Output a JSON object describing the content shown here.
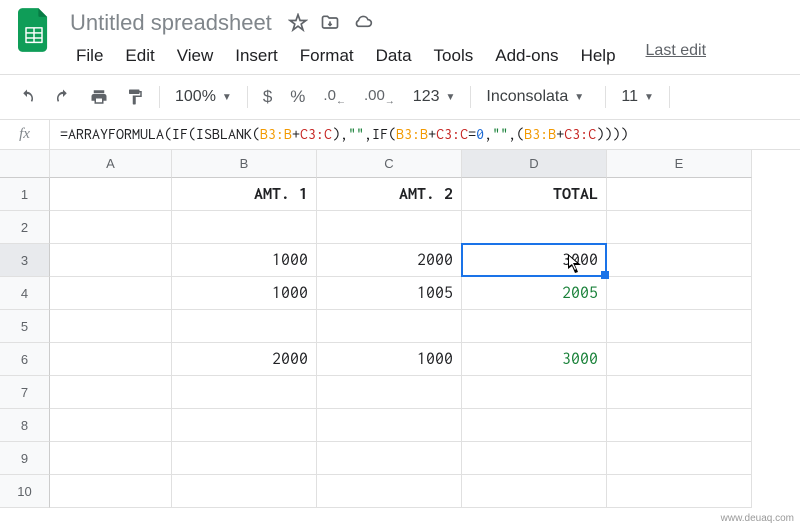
{
  "doc": {
    "title": "Untitled spreadsheet",
    "last_edit": "Last edit"
  },
  "menu": {
    "file": "File",
    "edit": "Edit",
    "view": "View",
    "insert": "Insert",
    "format": "Format",
    "data": "Data",
    "tools": "Tools",
    "addons": "Add-ons",
    "help": "Help"
  },
  "toolbar": {
    "zoom": "100%",
    "currency": "$",
    "percent": "%",
    "dec_dec": ".0",
    "dec_inc": ".00",
    "num_format": "123",
    "font": "Inconsolata",
    "font_size": "11"
  },
  "formula": {
    "prefix": "=ARRAYFORMULA(IF(ISBLANK(",
    "r1a": "B3:B",
    "plus1": "+",
    "r2a": "C3:C",
    "mid1": "),",
    "s1": "\"\"",
    "mid2": ",IF(",
    "r1b": "B3:B",
    "plus2": "+",
    "r2b": "C3:C",
    "eq": "=",
    "zero": "0",
    "mid3": ",",
    "s2": "\"\"",
    "mid4": ",(",
    "r1c": "B3:B",
    "plus3": "+",
    "r2c": "C3:C",
    "suffix": "))))"
  },
  "columns": [
    "A",
    "B",
    "C",
    "D",
    "E"
  ],
  "rows": [
    "1",
    "2",
    "3",
    "4",
    "5",
    "6",
    "7",
    "8",
    "9",
    "10"
  ],
  "cells": {
    "B1": "AMT. 1",
    "C1": "AMT. 2",
    "D1": "TOTAL",
    "B3": "1000",
    "C3": "2000",
    "D3": "3000",
    "B4": "1000",
    "C4": "1005",
    "D4": "2005",
    "B6": "2000",
    "C6": "1000",
    "D6": "3000"
  },
  "chart_data": {
    "type": "table",
    "headers": [
      "AMT. 1",
      "AMT. 2",
      "TOTAL"
    ],
    "rows": [
      [
        1000,
        2000,
        3000
      ],
      [
        1000,
        1005,
        2005
      ],
      [
        null,
        null,
        null
      ],
      [
        2000,
        1000,
        3000
      ]
    ],
    "formula": "=ARRAYFORMULA(IF(ISBLANK(B3:B+C3:C),\"\",IF(B3:B+C3:C=0,\"\",(B3:B+C3:C))))",
    "active_cell": "D3"
  },
  "watermark": "www.deuaq.com"
}
